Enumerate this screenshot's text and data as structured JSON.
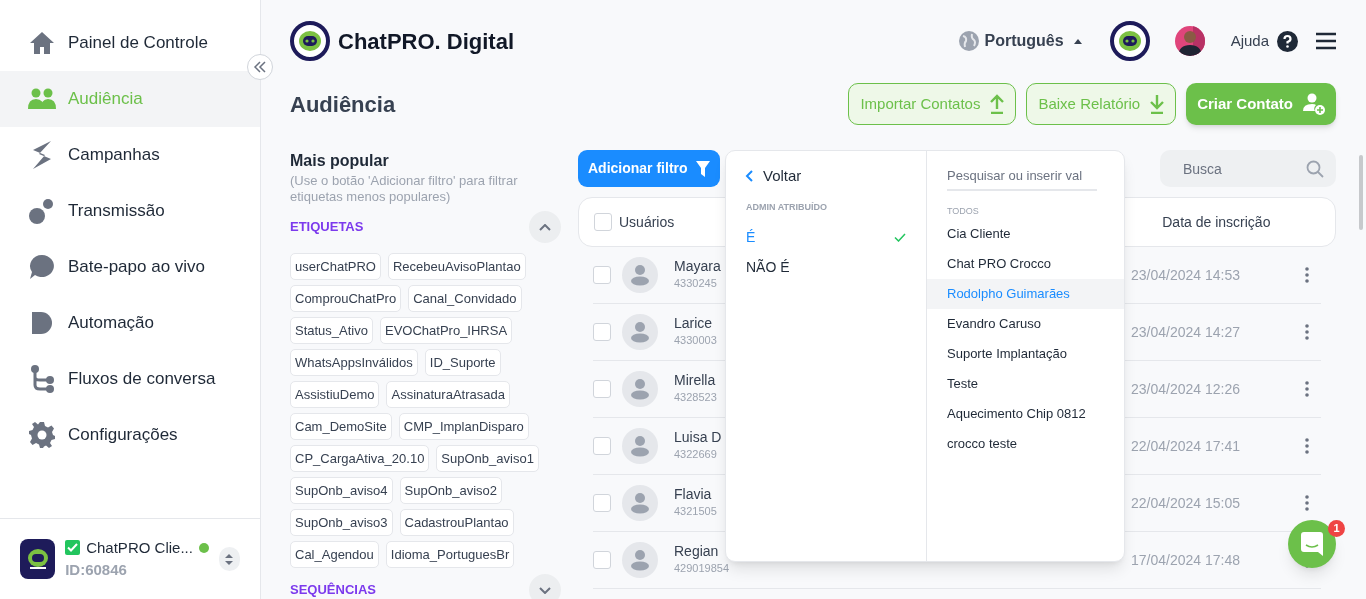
{
  "sidebar": {
    "items": [
      {
        "label": "Painel de Controle",
        "selected": false
      },
      {
        "label": "Audiência",
        "selected": true
      },
      {
        "label": "Campanhas",
        "selected": false
      },
      {
        "label": "Transmissão",
        "selected": false
      },
      {
        "label": "Bate-papo ao vivo",
        "selected": false
      },
      {
        "label": "Automação",
        "selected": false
      },
      {
        "label": "Fluxos de conversa",
        "selected": false
      },
      {
        "label": "Configurações",
        "selected": false
      }
    ],
    "account": {
      "name": "ChatPRO Clie...",
      "id": "ID:60846",
      "verified": true,
      "online": true
    }
  },
  "header": {
    "brand": "ChatPRO. Digital",
    "language": "Português",
    "help": "Ajuda"
  },
  "page_title": "Audiência",
  "actions": [
    {
      "label": "Importar Contatos",
      "kind": "import"
    },
    {
      "label": "Baixe Relatório",
      "kind": "download"
    },
    {
      "label": "Criar Contato",
      "kind": "create"
    }
  ],
  "filters": {
    "title": "Mais popular",
    "hint": "(Use o botão 'Adicionar filtro' para filtrar etiquetas menos populares)",
    "sections": [
      {
        "title": "ETIQUETAS",
        "expanded": true,
        "tags": [
          "userChatPRO",
          "RecebeuAvisoPlantao",
          "ComprouChatPro",
          "Canal_Convidado",
          "Status_Ativo",
          "EVOChatPro_IHRSA",
          "WhatsAppsInválidos",
          "ID_Suporte",
          "AssistiuDemo",
          "AssinaturaAtrasada",
          "Cam_DemoSite",
          "CMP_ImplanDisparo",
          "CP_CargaAtiva_20.10",
          "SupOnb_aviso1",
          "SupOnb_aviso4",
          "SupOnb_aviso2",
          "SupOnb_aviso3",
          "CadastrouPlantao",
          "Cal_Agendou",
          "Idioma_PortuguesBr"
        ]
      },
      {
        "title": "SEQUÊNCIAS",
        "expanded": false
      }
    ]
  },
  "add_filter": "Adicionar filtro",
  "search": {
    "placeholder": "Busca"
  },
  "table": {
    "columns": [
      "Usuários",
      "Data de inscrição"
    ],
    "all_checked": false,
    "rows": [
      {
        "name": "Mayara",
        "id": "4330245",
        "date": "23/04/2024 14:53",
        "checked": false
      },
      {
        "name": "Larice",
        "id": "4330003",
        "date": "23/04/2024 14:27",
        "checked": false
      },
      {
        "name": "Mirella",
        "id": "4328523",
        "date": "23/04/2024 12:26",
        "checked": false
      },
      {
        "name": "Luisa D",
        "id": "4322669",
        "date": "22/04/2024 17:41",
        "checked": false
      },
      {
        "name": "Flavia",
        "id": "4321505",
        "date": "22/04/2024 15:05",
        "checked": false
      },
      {
        "name": "Regian",
        "id": "429019854",
        "date": "17/04/2024 17:48",
        "checked": false
      }
    ]
  },
  "filter_menu": {
    "back": "Voltar",
    "group": "ADMIN ATRIBUÍDO",
    "operators": [
      {
        "label": "É",
        "selected": true
      },
      {
        "label": "NÃO É",
        "selected": false
      }
    ],
    "value_search": {
      "placeholder": "Pesquisar ou inserir val"
    },
    "values_group": "TODOS",
    "values": [
      {
        "label": "Cia Cliente",
        "selected": false
      },
      {
        "label": "Chat PRO Crocco",
        "selected": false
      },
      {
        "label": "Rodolpho Guimarães",
        "selected": true
      },
      {
        "label": "Evandro Caruso",
        "selected": false
      },
      {
        "label": "Suporte Implantação",
        "selected": false
      },
      {
        "label": "Teste",
        "selected": false
      },
      {
        "label": "Aquecimento Chip 0812",
        "selected": false
      },
      {
        "label": "crocco teste",
        "selected": false
      }
    ]
  },
  "chat_badge": "1"
}
